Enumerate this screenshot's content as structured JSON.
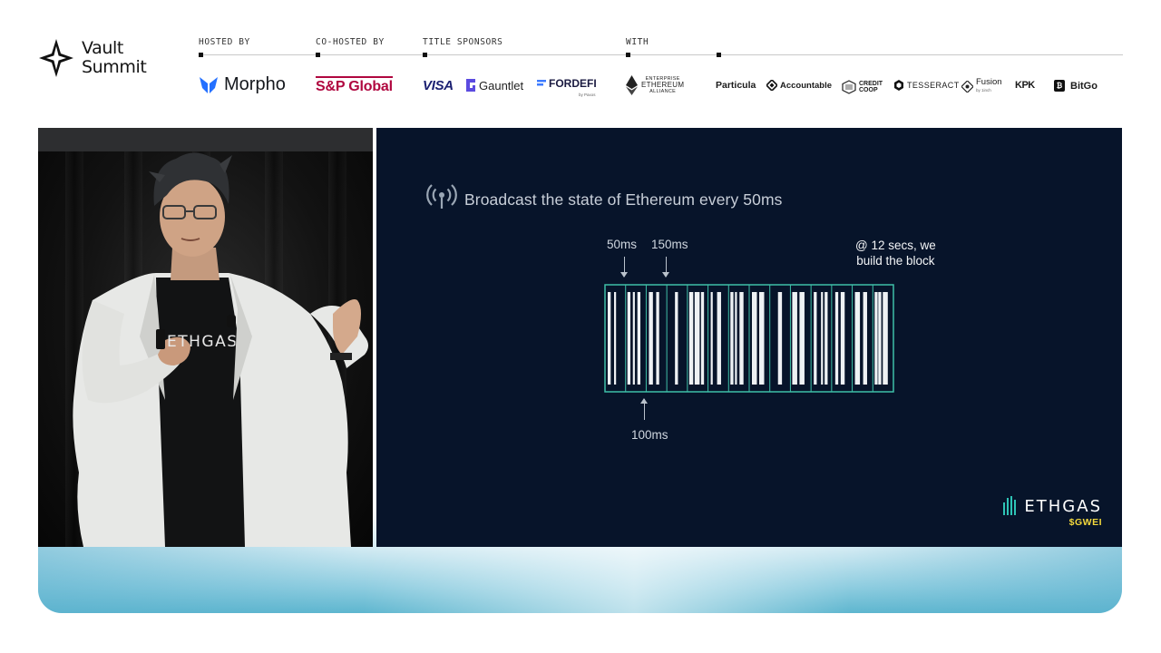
{
  "brand": {
    "name_line1": "Vault",
    "name_line2": "Summit"
  },
  "sponsor_groups": {
    "hosted_by": "HOSTED BY",
    "co_hosted_by": "CO-HOSTED BY",
    "title_sponsors": "TITLE SPONSORS",
    "with": "WITH"
  },
  "sponsors": {
    "morpho": "Morpho",
    "sp_global": "S&P Global",
    "visa": "VISA",
    "gauntlet": "Gauntlet",
    "fordefi": "FORDEFI",
    "fordefi_sub": "by Paxos",
    "eea_line1": "ENTERPRISE",
    "eea_line2": "ETHEREUM",
    "eea_line3": "ALLIANCE",
    "particula": "Particula",
    "accountable": "Accountable",
    "credit_coop_line1": "CREDIT",
    "credit_coop_line2": "COOP",
    "tesseract": "TESSERACT",
    "fusion": "Fusion",
    "fusion_sub": "by 1inch",
    "kpk": "KPK",
    "bitgo": "BitGo"
  },
  "video": {
    "shirt_text": "ETHGAS"
  },
  "slide": {
    "title": "Broadcast the state of Ethereum every 50ms",
    "label_50ms": "50ms",
    "label_150ms": "150ms",
    "label_100ms": "100ms",
    "label_block_line1": "@ 12 secs, we",
    "label_block_line2": "build the block",
    "block_frame_color": "#3fbfa8",
    "segments": 14,
    "footer_brand": "ETHGAS",
    "footer_ticker": "$GWEI",
    "ticker_color": "#f4d93c"
  }
}
